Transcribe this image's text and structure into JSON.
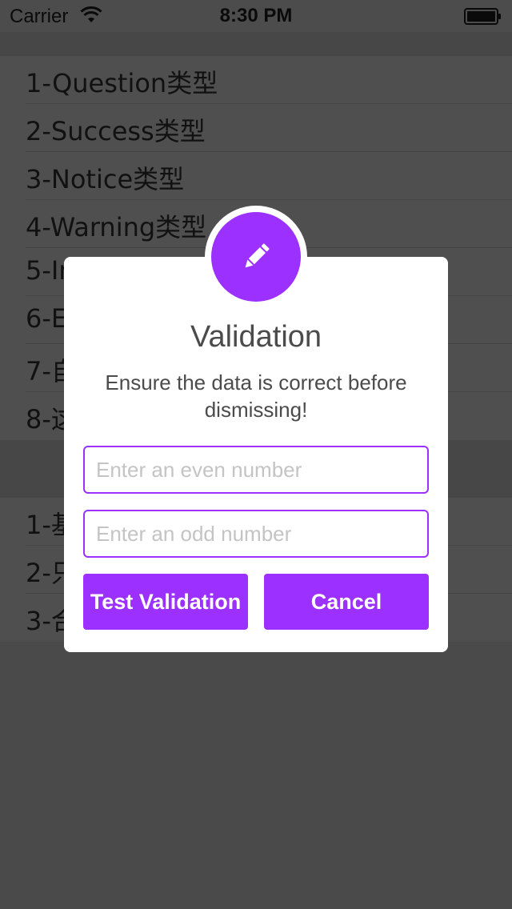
{
  "status_bar": {
    "carrier": "Carrier",
    "time": "8:30 PM"
  },
  "list": {
    "section1": [
      {
        "label": "1-Question类型"
      },
      {
        "label": "2-Success类型"
      },
      {
        "label": "3-Notice类型"
      },
      {
        "label": "4-Warning类型"
      },
      {
        "label": "5-In"
      },
      {
        "label": "6-E"
      },
      {
        "label": "7-自"
      },
      {
        "label": "8-这"
      }
    ],
    "section2": [
      {
        "label": "1-基"
      },
      {
        "label": "2-只"
      },
      {
        "label": "3-合"
      }
    ]
  },
  "dialog": {
    "icon": "pencil-icon",
    "title": "Validation",
    "message": "Ensure the data is correct before dismissing!",
    "even_placeholder": "Enter an even number",
    "odd_placeholder": "Enter an odd number",
    "test_button": "Test Validation",
    "cancel_button": "Cancel"
  },
  "colors": {
    "accent": "#9b30ff",
    "overlay": "#4a4a4a"
  }
}
